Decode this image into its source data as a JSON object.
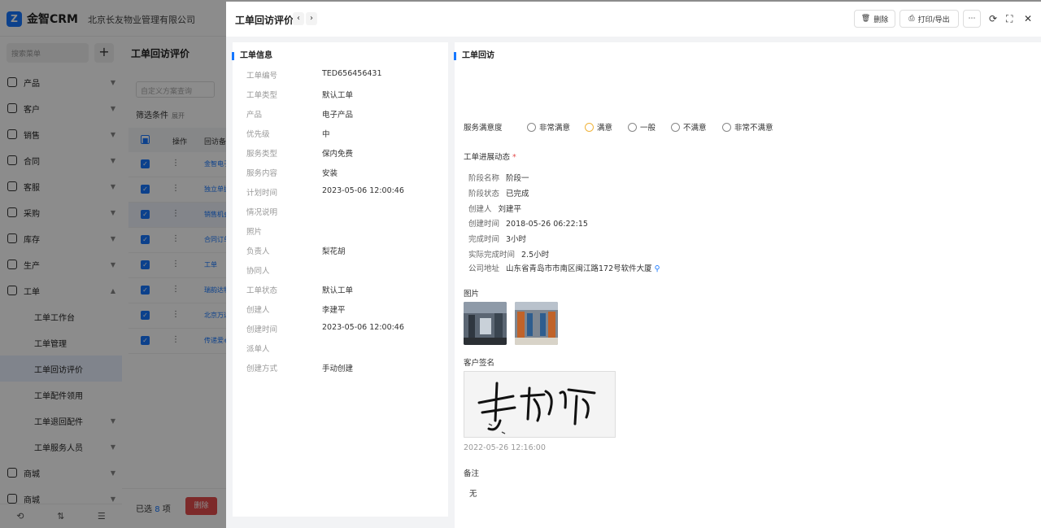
{
  "app": {
    "logo": "金智CRM",
    "company": "北京长友物业管理有限公司"
  },
  "sidebar": {
    "search_placeholder": "搜索菜单",
    "items": [
      {
        "label": "产品"
      },
      {
        "label": "客户"
      },
      {
        "label": "销售"
      },
      {
        "label": "合同"
      },
      {
        "label": "客服"
      },
      {
        "label": "采购"
      },
      {
        "label": "库存"
      },
      {
        "label": "生产"
      },
      {
        "label": "工单"
      }
    ],
    "sub_items": [
      {
        "label": "工单工作台"
      },
      {
        "label": "工单管理"
      },
      {
        "label": "工单回访评价"
      },
      {
        "label": "工单配件领用"
      },
      {
        "label": "工单退回配件"
      },
      {
        "label": "工单服务人员"
      }
    ],
    "bottom_items": [
      {
        "label": "商城"
      },
      {
        "label": "商城"
      }
    ]
  },
  "list": {
    "title": "工单回访评价",
    "scheme_placeholder": "自定义方案查询",
    "filter_label": "筛选条件",
    "expand_label": "展开",
    "col_op": "操作",
    "col_name": "回访备注",
    "rows": [
      {
        "name": "金智电子"
      },
      {
        "name": "独立单据"
      },
      {
        "name": "销售机会"
      },
      {
        "name": "合同订单"
      },
      {
        "name": "工单"
      },
      {
        "name": "瑞韵达物流"
      },
      {
        "name": "北京万达"
      },
      {
        "name": "传递爱心"
      }
    ],
    "selected_prefix": "已选",
    "selected_count": "8",
    "selected_unit": "项",
    "delete_label": "删除"
  },
  "drawer": {
    "title": "工单回访评价",
    "delete_label": "删除",
    "print_label": "打印/导出",
    "info_title": "工单信息",
    "fields": [
      {
        "label": "工单编号",
        "value": "TED656456431"
      },
      {
        "label": "工单类型",
        "value": "默认工单"
      },
      {
        "label": "产品",
        "value": "电子产品"
      },
      {
        "label": "优先级",
        "value": "中"
      },
      {
        "label": "服务类型",
        "value": "保内免费"
      },
      {
        "label": "服务内容",
        "value": "安装"
      },
      {
        "label": "计划时间",
        "value": "2023-05-06 12:00:46"
      },
      {
        "label": "情况说明",
        "value": ""
      },
      {
        "label": "照片",
        "value": ""
      },
      {
        "label": "负责人",
        "value": "梨花胡"
      },
      {
        "label": "协同人",
        "value": ""
      },
      {
        "label": "工单状态",
        "value": "默认工单"
      },
      {
        "label": "创建人",
        "value": "李建平"
      },
      {
        "label": "创建时间",
        "value": "2023-05-06 12:00:46"
      },
      {
        "label": "派单人",
        "value": ""
      },
      {
        "label": "创建方式",
        "value": "手动创建"
      }
    ],
    "visit_title": "工单回访",
    "satisfaction_label": "服务满意度",
    "satisfaction_options": [
      {
        "label": "非常满意"
      },
      {
        "label": "满意"
      },
      {
        "label": "一般"
      },
      {
        "label": "不满意"
      },
      {
        "label": "非常不满意"
      }
    ],
    "satisfaction_selected": "满意",
    "progress_title": "工单进展动态",
    "progress": [
      {
        "label": "阶段名称",
        "value": "阶段一"
      },
      {
        "label": "阶段状态",
        "value": "已完成"
      },
      {
        "label": "创建人",
        "value": "刘建平"
      },
      {
        "label": "创建时间",
        "value": "2018-05-26 06:22:15"
      },
      {
        "label": "完成时间",
        "value": "3小时"
      },
      {
        "label": "实际完成时间",
        "value": "2.5小时"
      },
      {
        "label": "公司地址",
        "value": "山东省青岛市市南区闽江路172号软件大厦"
      }
    ],
    "pictures_label": "图片",
    "signature_label": "客户签名",
    "signature_time": "2022-05-26 12:16:00",
    "remark_label": "备注",
    "remark_value": "无"
  },
  "colors": {
    "primary": "#1677ff",
    "danger": "#e34d4d",
    "satisfied": "#f0b33a"
  }
}
